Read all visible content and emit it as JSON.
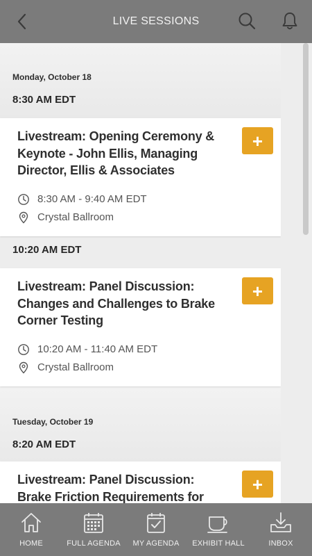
{
  "header": {
    "title": "LIVE SESSIONS"
  },
  "days": [
    {
      "date": "Monday, October 18",
      "slots": [
        {
          "time": "8:30 AM EDT",
          "session": {
            "title": "Livestream: Opening Ceremony & Keynote - John Ellis, Managing Director, Ellis & Associates",
            "time_range": "8:30 AM - 9:40 AM EDT",
            "location": "Crystal Ballroom",
            "add_label": "+"
          }
        },
        {
          "time": "10:20 AM EDT",
          "session": {
            "title": "Livestream: Panel Discussion: Changes and Challenges to Brake Corner Testing",
            "time_range": "10:20 AM - 11:40 AM EDT",
            "location": "Crystal Ballroom",
            "add_label": "+"
          }
        }
      ]
    },
    {
      "date": "Tuesday, October 19",
      "slots": [
        {
          "time": "8:20 AM EDT",
          "session": {
            "title": "Livestream: Panel Discussion: Brake Friction Requirements for",
            "add_label": "+"
          }
        }
      ]
    }
  ],
  "nav": {
    "items": [
      {
        "label": "HOME",
        "icon": "home-icon"
      },
      {
        "label": "FULL AGENDA",
        "icon": "calendar-icon"
      },
      {
        "label": "MY AGENDA",
        "icon": "calendar-check-icon"
      },
      {
        "label": "EXHIBIT HALL",
        "icon": "coffee-cup-icon"
      },
      {
        "label": "INBOX",
        "icon": "inbox-download-icon"
      }
    ]
  },
  "colors": {
    "header_bg": "#7b7b7b",
    "accent": "#e6a323",
    "page_bg": "#ededed"
  }
}
